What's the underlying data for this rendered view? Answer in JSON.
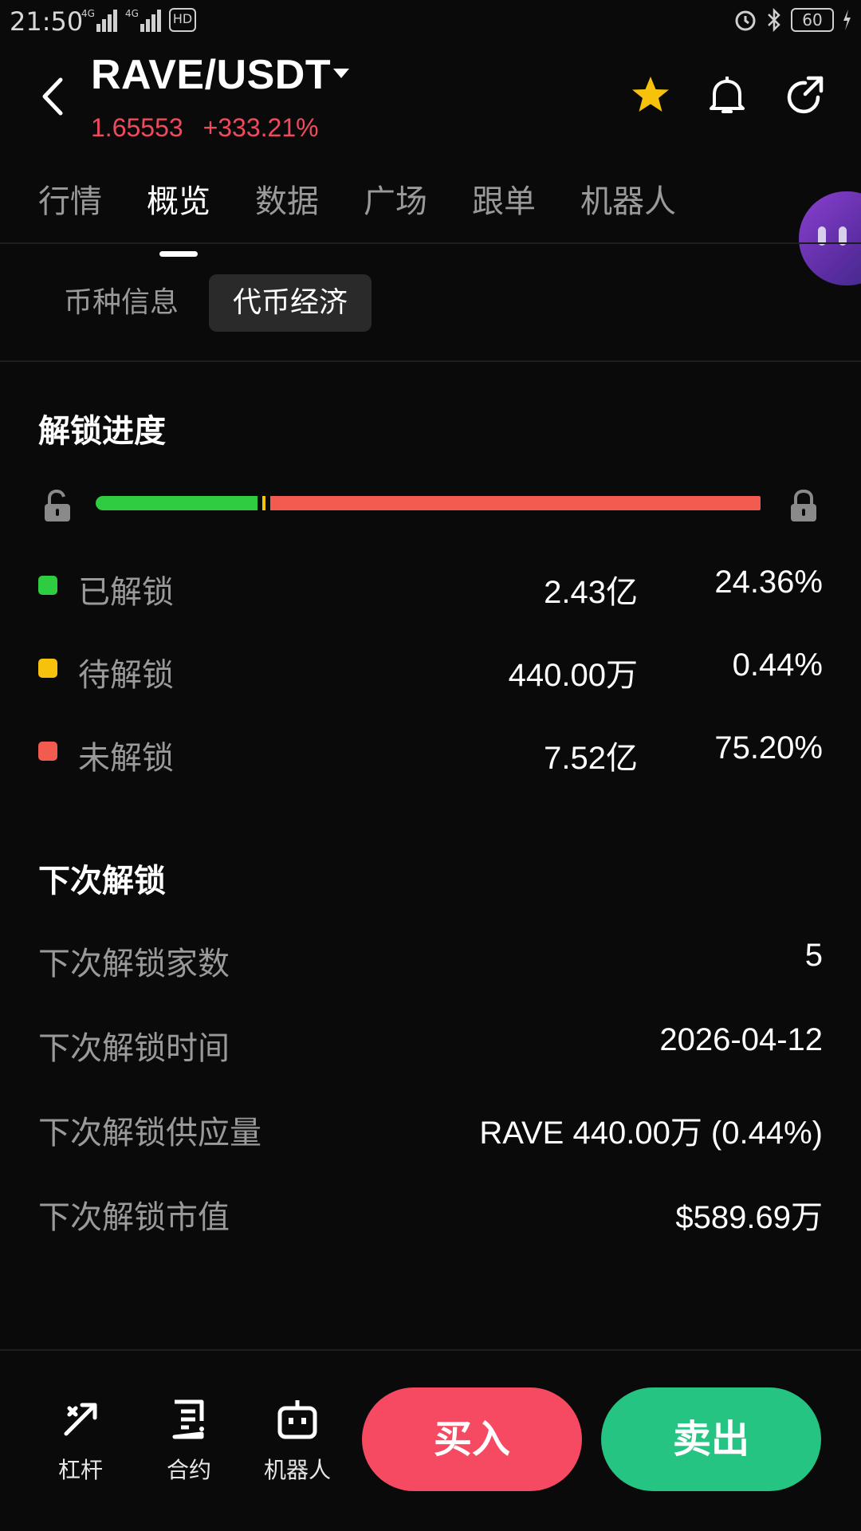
{
  "status_bar": {
    "time": "21:50",
    "signal1_label": "4G",
    "signal2_label": "4G",
    "hd_label": "HD",
    "battery": "60"
  },
  "header": {
    "pair": "RAVE/USDT",
    "price": "1.65553",
    "change": "+333.21%",
    "price_color": "#f04a5f",
    "star_color": "#f6c20c"
  },
  "tabs": [
    {
      "label": "行情",
      "active": false
    },
    {
      "label": "概览",
      "active": true
    },
    {
      "label": "数据",
      "active": false
    },
    {
      "label": "广场",
      "active": false
    },
    {
      "label": "跟单",
      "active": false
    },
    {
      "label": "机器人",
      "active": false
    }
  ],
  "subtabs": {
    "coin_info": "币种信息",
    "token_economy": "代币经济",
    "active": "token_economy"
  },
  "unlock_progress": {
    "title": "解锁进度",
    "unlocked_fraction": 0.2436,
    "pending_fraction": 0.0044,
    "locked_fraction": 0.752,
    "rows": [
      {
        "label": "已解锁",
        "amount": "2.43亿",
        "percent": "24.36%",
        "color": "#2ecc40"
      },
      {
        "label": "待解锁",
        "amount": "440.00万",
        "percent": "0.44%",
        "color": "#f6c20c"
      },
      {
        "label": "未解锁",
        "amount": "7.52亿",
        "percent": "75.20%",
        "color": "#f25c50"
      }
    ]
  },
  "next_unlock": {
    "title": "下次解锁",
    "rows": [
      {
        "label": "下次解锁家数",
        "value": "5"
      },
      {
        "label": "下次解锁时间",
        "value": "2026-04-12"
      },
      {
        "label": "下次解锁供应量",
        "value": "RAVE 440.00万 (0.44%)"
      },
      {
        "label": "下次解锁市值",
        "value": "$589.69万"
      }
    ]
  },
  "bottom_bar": {
    "leverage": "杠杆",
    "contract": "合约",
    "robot": "机器人",
    "buy": "买入",
    "sell": "卖出",
    "buy_color": "#f54a62",
    "sell_color": "#26c483"
  },
  "icons": [
    "back-arrow-icon",
    "star-icon",
    "bell-icon",
    "share-icon",
    "unlock-icon",
    "lock-icon",
    "leverage-icon",
    "contract-icon",
    "robot-icon",
    "assistant-bubble-icon"
  ]
}
